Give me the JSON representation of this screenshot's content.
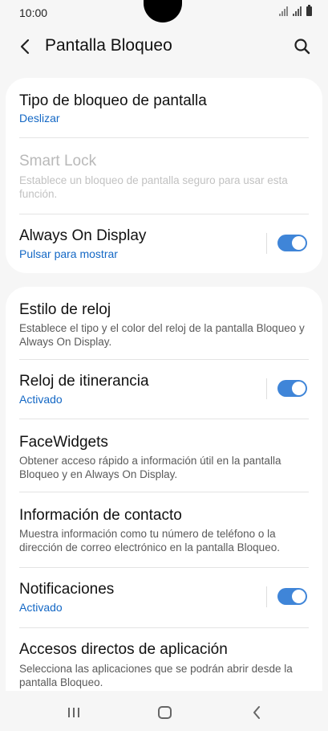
{
  "status": {
    "time": "10:00"
  },
  "header": {
    "title": "Pantalla Bloqueo",
    "back_icon": "back-arrow-icon",
    "search_icon": "search-icon"
  },
  "card1": {
    "screen_lock_type": {
      "title": "Tipo de bloqueo de pantalla",
      "value": "Deslizar"
    },
    "smart_lock": {
      "title": "Smart Lock",
      "desc": "Establece un bloqueo de pantalla seguro para usar esta función."
    },
    "always_on_display": {
      "title": "Always On Display",
      "value": "Pulsar para mostrar",
      "enabled": true
    }
  },
  "card2": {
    "clock_style": {
      "title": "Estilo de reloj",
      "desc": "Establece el tipo y el color del reloj de la pantalla Bloqueo y Always On Display."
    },
    "roaming_clock": {
      "title": "Reloj de itinerancia",
      "value": "Activado",
      "enabled": true
    },
    "facewidgets": {
      "title": "FaceWidgets",
      "desc": "Obtener acceso rápido a información útil en la pantalla Bloqueo y en Always On Display."
    },
    "contact_info": {
      "title": "Información de contacto",
      "desc": "Muestra información como tu número de teléfono o la dirección de correo electrónico en la pantalla Bloqueo."
    },
    "notifications": {
      "title": "Notificaciones",
      "value": "Activado",
      "enabled": true
    },
    "app_shortcuts": {
      "title": "Accesos directos de aplicación",
      "desc": "Selecciona las aplicaciones que se podrán abrir desde la pantalla Bloqueo."
    }
  },
  "colors": {
    "accent": "#3f85d8",
    "link": "#1468c5"
  }
}
